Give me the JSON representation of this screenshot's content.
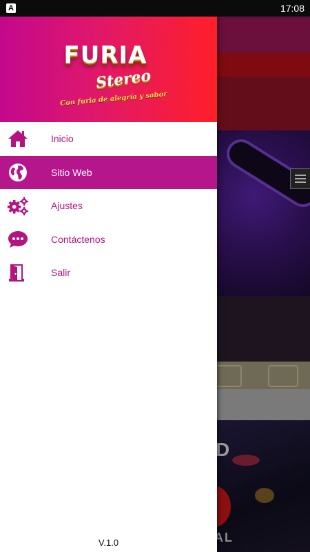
{
  "status_bar": {
    "app_badge": "A",
    "time": "17:08"
  },
  "drawer": {
    "logo": {
      "line1": "FURIA",
      "line2": "Stereo",
      "slogan": "Con furia de alegría y sabor"
    },
    "items": [
      {
        "label": "Inicio",
        "icon": "home-icon",
        "active": false
      },
      {
        "label": "Sitio Web",
        "icon": "globe-icon",
        "active": true
      },
      {
        "label": "Ajustes",
        "icon": "gears-icon",
        "active": false
      },
      {
        "label": "Contáctenos",
        "icon": "chat-icon",
        "active": false
      },
      {
        "label": "Salir",
        "icon": "exit-door-icon",
        "active": false
      }
    ],
    "version": "V.1.0"
  },
  "background": {
    "partial_letter": "D",
    "partial_text": "AL"
  },
  "colors": {
    "accent": "#b5168c",
    "header_start": "#c3088d",
    "header_end": "#ff1f29",
    "label": "#b3147f"
  }
}
